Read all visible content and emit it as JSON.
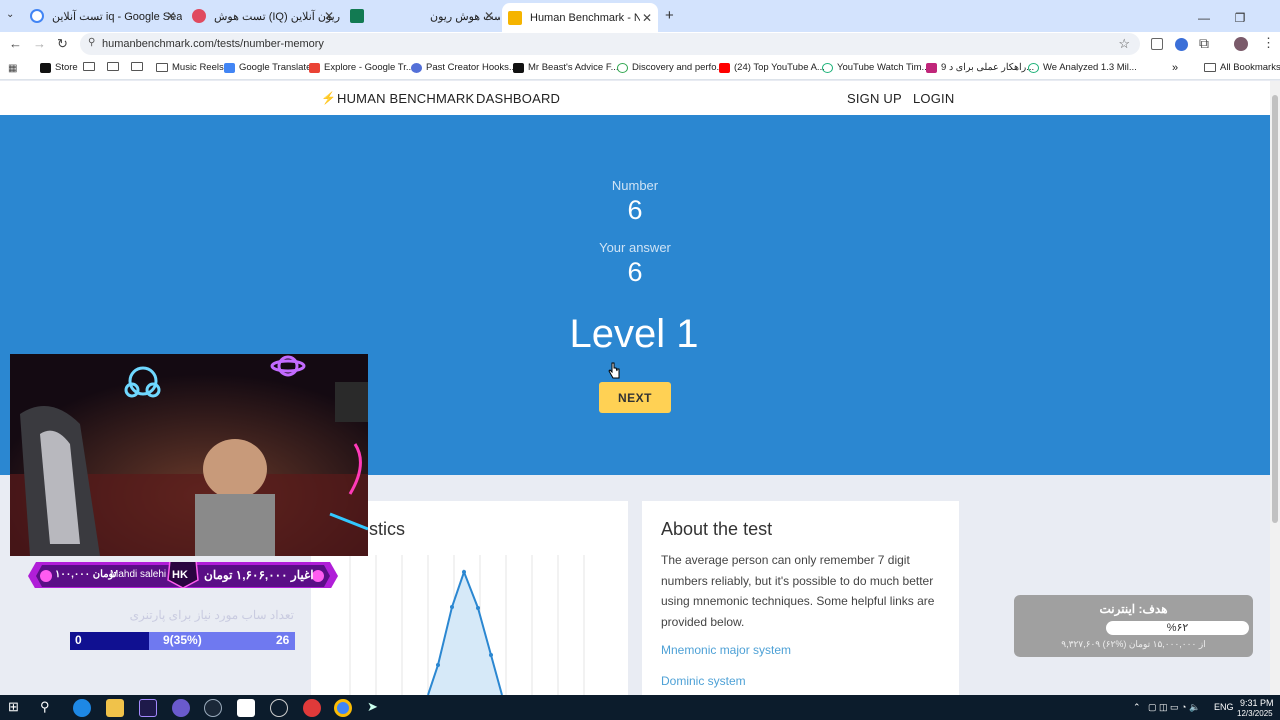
{
  "browser": {
    "tabs": [
      {
        "title": "تست آنلاین iq - Google Search",
        "favicon_color": "#4285f4"
      },
      {
        "title": "تست هوش (IQ) ریون آنلاین",
        "favicon_color": "#e04a5f"
      },
      {
        "title": "تست هوش ریون",
        "favicon_color": "#127a52"
      },
      {
        "title": "Human Benchmark - Number M",
        "favicon_color": "#f5b400"
      }
    ],
    "new_tab_label": "+",
    "url": "humanbenchmark.com/tests/number-memory",
    "bookmarks": [
      {
        "label": "Store",
        "color": "#111111"
      },
      {
        "label": "",
        "color": ""
      },
      {
        "label": "",
        "color": ""
      },
      {
        "label": "Music Reels",
        "color": ""
      },
      {
        "label": "Google Translate",
        "color": "#4285f4"
      },
      {
        "label": "Explore - Google Tr...",
        "color": "#ea4335"
      },
      {
        "label": "Past Creator Hooks...",
        "color": "#5470d8"
      },
      {
        "label": "Mr Beast's Advice F...",
        "color": "#111111"
      },
      {
        "label": "Discovery and perfo...",
        "color": "#34a853"
      },
      {
        "label": "(24) Top YouTube A...",
        "color": "#ff0000"
      },
      {
        "label": "YouTube Watch Tim...",
        "color": "#1fb37a"
      },
      {
        "label": "9 راهکار عملی برای د...",
        "color": "#c0267a"
      },
      {
        "label": "We Analyzed 1.3 Mil...",
        "color": "#1fb37a"
      }
    ],
    "all_bookmarks_label": "All Bookmarks"
  },
  "site": {
    "brand": "HUMAN BENCHMARK",
    "dashboard": "DASHBOARD",
    "signup": "SIGN UP",
    "login": "LOGIN"
  },
  "test": {
    "number_label": "Number",
    "number_value": "6",
    "answer_label": "Your answer",
    "answer_value": "6",
    "level": "Level 1",
    "next_label": "NEXT"
  },
  "about": {
    "stats_title_fragment": "stics",
    "title": "About the test",
    "text": "The average person can only remember 7 digit numbers reliably, but it's possible to do much better using mnemonic techniques. Some helpful links are provided below.",
    "links": [
      "Mnemonic major system",
      "Dominic system"
    ]
  },
  "overlay": {
    "donor_amount": "۱۰۰,۰۰۰ تومان",
    "donor_name": "Mahdi salehi",
    "donor_badge": "HK",
    "donor_right": "اغیار ۱,۶۰۶,۰۰۰ تومان",
    "partner_text": "تعداد ساب مورد نیاز برای پارتنری",
    "partner_start": "0",
    "partner_current": "9(35%)",
    "partner_target": "26",
    "partner_fraction": 0.35,
    "goal_title": "هدف: اینترنت",
    "goal_percent": "%۶۲",
    "goal_sub": "۹,۳۲۷,۶۰۹ از ۱۵,۰۰۰,۰۰۰ تومان (%۶۲)"
  },
  "taskbar": {
    "lang": "ENG",
    "time": "9:31 PM",
    "date": "12/3/2025"
  }
}
